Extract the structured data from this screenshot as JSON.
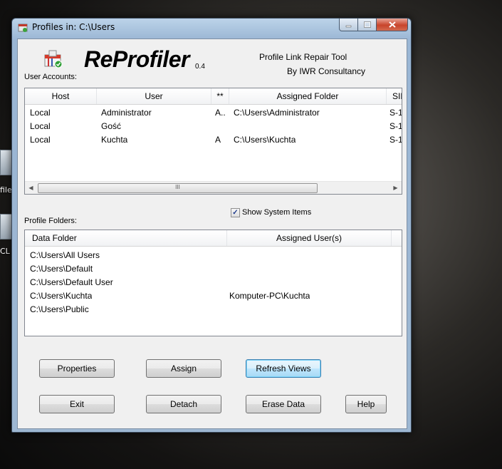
{
  "window": {
    "title": "Profiles in: C:\\Users"
  },
  "header": {
    "logo_text": "ReProfiler",
    "version": "0.4",
    "tagline": "Profile Link Repair Tool",
    "byline": "By IWR Consultancy"
  },
  "desktop": {
    "label1": "file",
    "label2": "CL"
  },
  "accounts": {
    "label": "User Accounts:",
    "columns": [
      "Host",
      "User",
      "**",
      "Assigned Folder",
      "SID"
    ],
    "rows": [
      [
        "Local",
        "Administrator",
        "A..",
        "C:\\Users\\Administrator",
        "S-1"
      ],
      [
        "Local",
        "Gość",
        "",
        "",
        "S-1"
      ],
      [
        "Local",
        "Kuchta",
        "A",
        "C:\\Users\\Kuchta",
        "S-1"
      ]
    ],
    "scroll_grip": "III"
  },
  "folders": {
    "label": "Profile Folders:",
    "show_system_label": "Show System Items",
    "show_system_checked": true,
    "columns": [
      "Data Folder",
      "Assigned User(s)"
    ],
    "rows": [
      [
        "C:\\Users\\All Users",
        ""
      ],
      [
        "C:\\Users\\Default",
        ""
      ],
      [
        "C:\\Users\\Default User",
        ""
      ],
      [
        "C:\\Users\\Kuchta",
        "Komputer-PC\\Kuchta"
      ],
      [
        "C:\\Users\\Public",
        ""
      ]
    ]
  },
  "buttons": {
    "properties": "Properties",
    "assign": "Assign",
    "refresh": "Refresh Views",
    "exit": "Exit",
    "detach": "Detach",
    "erase": "Erase Data",
    "help": "Help"
  },
  "colors": {
    "accent": "#3c7fb1",
    "titlebar": "#9ab6d4",
    "close": "#c8442b"
  }
}
